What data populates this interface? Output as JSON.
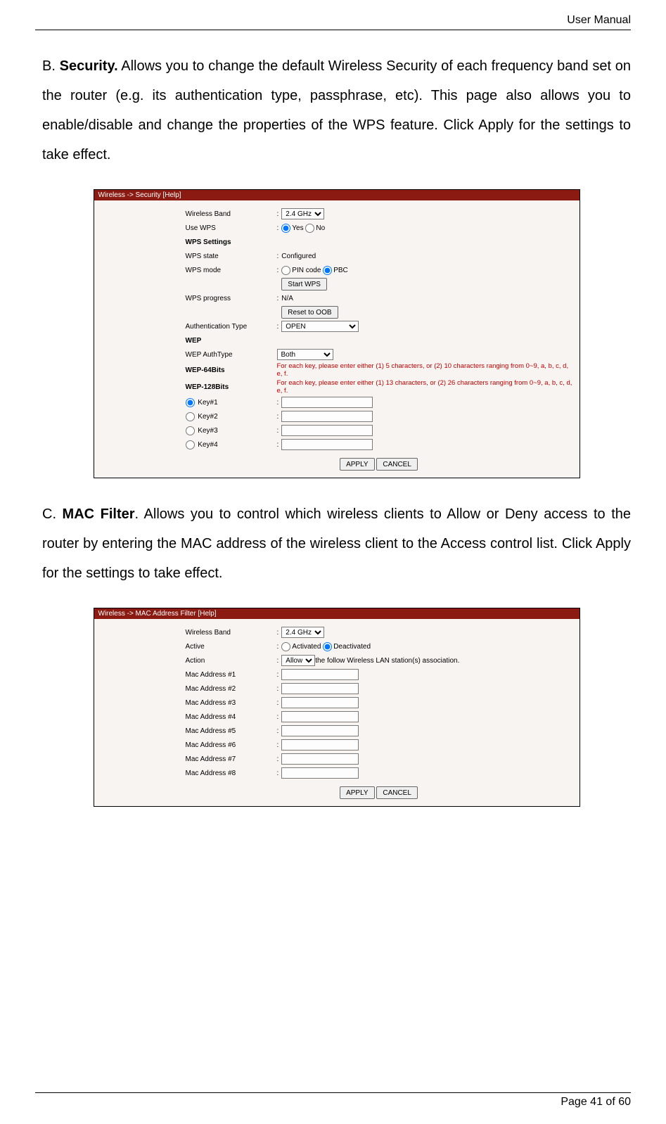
{
  "header": {
    "doc_title": "User Manual"
  },
  "footer": {
    "page_label": "Page 41 of 60"
  },
  "sections": {
    "b": {
      "letter": "B.",
      "title": "Security.",
      "body": " Allows you to change the default Wireless Security of each frequency band set on the router (e.g. its authentication type, passphrase, etc). This page also allows you to enable/disable and change the properties of the WPS feature. Click Apply for the settings to take effect."
    },
    "c": {
      "letter": "C.",
      "title": "MAC Filter",
      "body": ". Allows you to control which wireless clients to Allow or Deny access to the router by entering the MAC address of the wireless client to the Access control list. Click Apply for the settings to take effect."
    }
  },
  "panel_security": {
    "breadcrumb": "Wireless -> Security [Help]",
    "rows": {
      "wireless_band_lbl": "Wireless Band",
      "wireless_band_val": "2.4 GHz",
      "use_wps_lbl": "Use WPS",
      "use_wps_yes": "Yes",
      "use_wps_no": "No",
      "wps_settings_hdr": "WPS Settings",
      "wps_state_lbl": "WPS state",
      "wps_state_val": "Configured",
      "wps_mode_lbl": "WPS mode",
      "wps_mode_pin": "PIN code",
      "wps_mode_pbc": "PBC",
      "start_wps_btn": "Start WPS",
      "wps_progress_lbl": "WPS progress",
      "wps_progress_val": "N/A",
      "reset_oob_btn": "Reset to OOB",
      "auth_type_lbl": "Authentication Type",
      "auth_type_val": "OPEN",
      "wep_hdr": "WEP",
      "wep_authtype_lbl": "WEP AuthType",
      "wep_authtype_val": "Both",
      "wep64_lbl": "WEP-64Bits",
      "wep64_hint": "For each key, please enter either (1) 5 characters, or (2) 10 characters ranging from 0~9, a, b, c, d, e, f.",
      "wep128_lbl": "WEP-128Bits",
      "wep128_hint": "For each key, please enter either (1) 13 characters, or (2) 26 characters ranging from 0~9, a, b, c, d, e, f.",
      "key1_lbl": "Key#1",
      "key2_lbl": "Key#2",
      "key3_lbl": "Key#3",
      "key4_lbl": "Key#4",
      "apply_btn": "APPLY",
      "cancel_btn": "CANCEL"
    }
  },
  "panel_mac": {
    "breadcrumb": "Wireless -> MAC Address Filter [Help]",
    "rows": {
      "wireless_band_lbl": "Wireless Band",
      "wireless_band_val": "2.4 GHz",
      "active_lbl": "Active",
      "active_activated": "Activated",
      "active_deactivated": "Deactivated",
      "action_lbl": "Action",
      "action_val": "Allow",
      "action_suffix": " the follow Wireless LAN station(s) association.",
      "mac1": "Mac Address #1",
      "mac2": "Mac Address #2",
      "mac3": "Mac Address #3",
      "mac4": "Mac Address #4",
      "mac5": "Mac Address #5",
      "mac6": "Mac Address #6",
      "mac7": "Mac Address #7",
      "mac8": "Mac Address #8",
      "apply_btn": "APPLY",
      "cancel_btn": "CANCEL"
    }
  }
}
